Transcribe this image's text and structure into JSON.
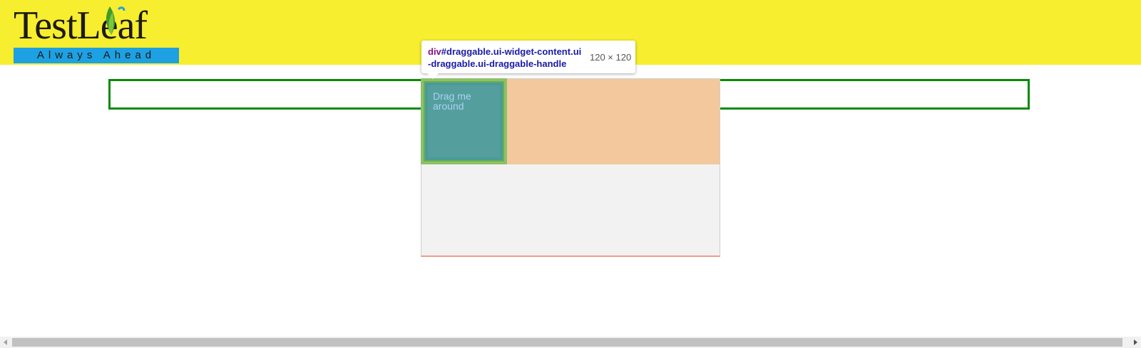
{
  "header": {
    "logo_title": "TestLeaf",
    "logo_tagline": "Always Ahead",
    "colors": {
      "background": "#f7ee2f",
      "tagline_bar": "#1da1e2"
    }
  },
  "draggable": {
    "label": "Drag me around",
    "colors": {
      "box": "#559e9e",
      "zone": "#f3c89c",
      "container": "#f2f2f2",
      "border": "#0a8a0a"
    }
  },
  "inspector_tooltip": {
    "tag": "div",
    "selector": "#draggable.ui-widget-content.ui-draggable.ui-draggable-handle",
    "dimensions": "120 × 120"
  },
  "scrollbar": {
    "left_arrow_icon": "chevron-left-icon",
    "right_arrow_icon": "chevron-right-icon"
  }
}
